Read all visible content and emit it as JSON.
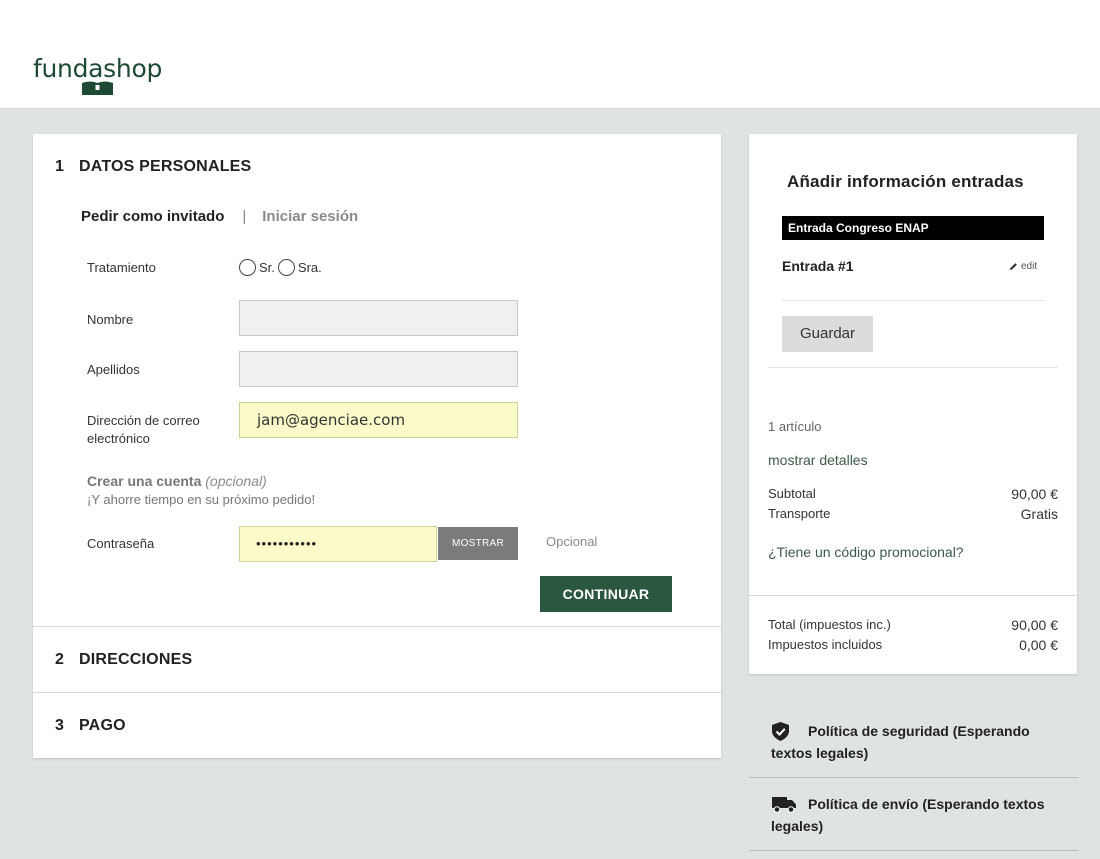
{
  "brand": {
    "logo_text": "fundashop",
    "color": "#1e4a34"
  },
  "checkout": {
    "steps": [
      {
        "number": "1",
        "title": "DATOS PERSONALES"
      },
      {
        "number": "2",
        "title": "DIRECCIONES"
      },
      {
        "number": "3",
        "title": "PAGO"
      }
    ],
    "tabs": {
      "guest": "Pedir como invitado",
      "separator": "|",
      "login": "Iniciar sesión"
    },
    "form": {
      "title_label": "Tratamiento",
      "options": [
        "Sr.",
        "Sra."
      ],
      "first_name_label": "Nombre",
      "first_name_value": "",
      "last_name_label": "Apellidos",
      "last_name_value": "",
      "email_label": "Dirección de correo electrónico",
      "email_value": "jam@agenciae.com",
      "create_account_title": "Crear una cuenta",
      "create_account_optional": "(opcional)",
      "create_account_subtitle": "¡Y ahorre tiempo en su próximo pedido!",
      "password_label": "Contraseña",
      "password_value": "•••••••••••",
      "show_button": "MOSTRAR",
      "password_hint": "Opcional",
      "continue_button": "CONTINUAR"
    }
  },
  "summary": {
    "title": "Añadir información entradas",
    "ticket_type": "Entrada Congreso ENAP",
    "entry_name": "Entrada #1",
    "edit_label": "edit",
    "save_button": "Guardar",
    "item_count": "1 artículo",
    "show_details": "mostrar detalles",
    "subtotal_label": "Subtotal",
    "subtotal_value": "90,00 €",
    "shipping_label": "Transporte",
    "shipping_value": "Gratis",
    "promo_link": "¿Tiene un código promocional?",
    "total_label": "Total (impuestos inc.)",
    "total_value": "90,00 €",
    "taxes_label": "Impuestos incluidos",
    "taxes_value": "0,00 €"
  },
  "policies": [
    {
      "icon": "shield-check-icon",
      "text": "Política de seguridad (Esperando textos legales)"
    },
    {
      "icon": "truck-icon",
      "text": "Política de envío (Esperando textos legales)"
    }
  ],
  "colors": {
    "primary_button": "#2b5640",
    "page_background": "#dfe3e3",
    "autofill_input": "#fafbc9"
  }
}
